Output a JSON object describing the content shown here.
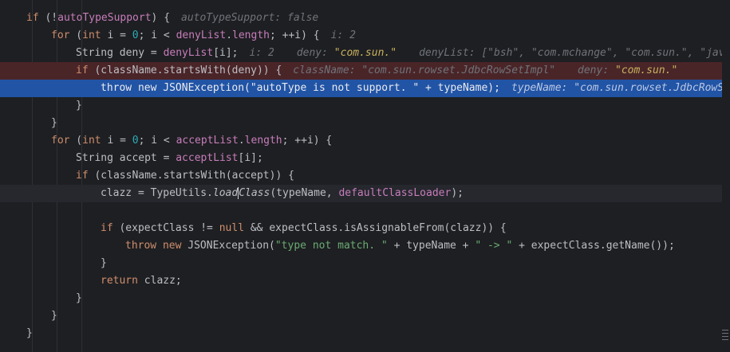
{
  "code": {
    "l1": {
      "if": "if",
      "open": " (!",
      "var": "autoTypeSupport",
      "close": ") {",
      "hint": "autoTypeSupport: ",
      "hint_val": "false"
    },
    "l2": {
      "for": "for",
      "a": " (",
      "int": "int",
      "b": " i = ",
      "zero": "0",
      "c": "; i < ",
      "list": "denyList",
      "d": ".",
      "len": "length",
      "e": "; ++i) {",
      "hint": "i: 2"
    },
    "l3": {
      "a": "String deny = ",
      "list": "denyList",
      "b": "[i];",
      "hint_i": "i: 2",
      "hint_deny": "deny: ",
      "hint_deny_val": "\"com.sun.\"",
      "hint_list": "denyList: [\"bsh\", \"com.mchange\", \"com.sun.\", \"java"
    },
    "l4": {
      "if": "if",
      "a": " (className.startsWith(deny)) {",
      "hint_cls": "className: \"com.sun.rowset.JdbcRowSetImpl\"",
      "hint_deny": "deny: ",
      "hint_deny_val": "\"com.sun.\""
    },
    "l5": {
      "throw": "throw",
      "new": "new",
      "a": " JSONException(",
      "str": "\"autoType is not support. \"",
      "b": " + typeName);",
      "hint": "typeName: \"com.sun.rowset.JdbcRowSe"
    },
    "l6": {
      "brace": "}"
    },
    "l7": {
      "brace": "}"
    },
    "l8": {
      "for": "for",
      "a": " (",
      "int": "int",
      "b": " i = ",
      "zero": "0",
      "c": "; i < ",
      "list": "acceptList",
      "d": ".",
      "len": "length",
      "e": "; ++i) {"
    },
    "l9": {
      "a": "String accept = ",
      "list": "acceptList",
      "b": "[i];"
    },
    "l10": {
      "if": "if",
      "a": " (className.startsWith(accept)) {"
    },
    "l11": {
      "a": "clazz = TypeUtils.",
      "m1": "load",
      "m2": "Class",
      "b": "(typeName, ",
      "field": "defaultClassLoader",
      "c": ");"
    },
    "l13": {
      "if": "if",
      "a": " (expectClass != ",
      "null": "null",
      "b": " && expectClass.isAssignableFrom(clazz)) {"
    },
    "l14": {
      "throw": "throw",
      "new": "new",
      "a": " JSONException(",
      "s1": "\"type not match. \"",
      "b": " + typeName + ",
      "s2": "\" -> \"",
      "c": " + expectClass.getName());"
    },
    "l15": {
      "brace": "}"
    },
    "l16": {
      "ret": "return",
      "a": " clazz;"
    },
    "l17": {
      "brace": "}"
    },
    "l18": {
      "brace": "}"
    },
    "l19": {
      "brace": "}"
    }
  }
}
